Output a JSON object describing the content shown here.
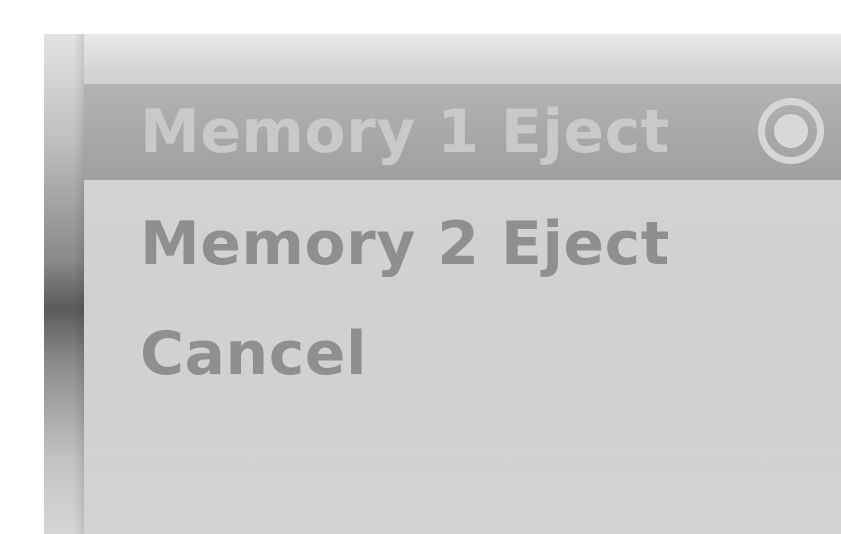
{
  "menu": {
    "items": [
      {
        "label": "Memory 1 Eject",
        "selected": true,
        "icon": "radio-selected-icon"
      },
      {
        "label": "Memory 2 Eject",
        "selected": false
      },
      {
        "label": "Cancel",
        "selected": false
      }
    ]
  },
  "colors": {
    "frame_light": "#d9d9d9",
    "panel": "#d0d0d0",
    "selected_bg": "#a8a8a8",
    "selected_text": "#c9c9c9",
    "item_text": "#8f8f8f",
    "border_shadow": "#5c5c5c"
  }
}
